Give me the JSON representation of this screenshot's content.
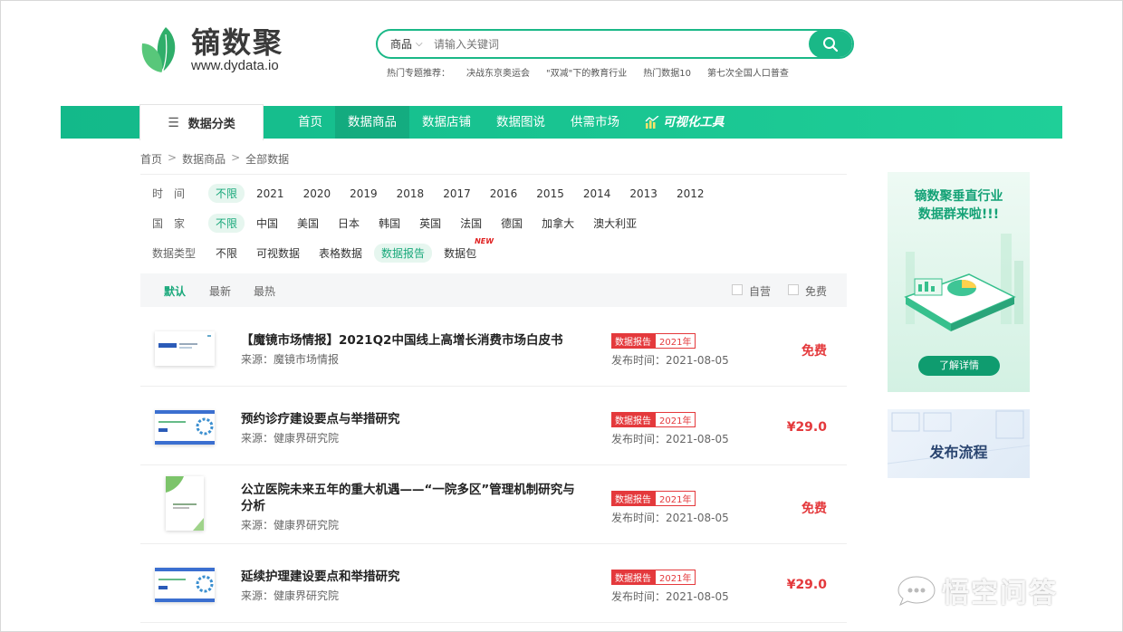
{
  "logo": {
    "name": "镝数聚",
    "url": "www.dydata.io"
  },
  "search": {
    "category": "商品",
    "placeholder": "请输入关键词"
  },
  "hot_topics": {
    "label": "热门专题推荐：",
    "items": [
      "决战东京奥运会",
      "\"双减\"下的教育行业",
      "热门数据10",
      "第七次全国人口普查"
    ]
  },
  "nav": {
    "category_button": "数据分类",
    "items": [
      "首页",
      "数据商品",
      "数据店铺",
      "数据图说",
      "供需市场",
      "可视化工具"
    ],
    "active": "数据商品"
  },
  "breadcrumb": [
    "首页",
    "数据商品",
    "全部数据"
  ],
  "filters": {
    "time": {
      "label": "时　间",
      "options": [
        "不限",
        "2021",
        "2020",
        "2019",
        "2018",
        "2017",
        "2016",
        "2015",
        "2014",
        "2013",
        "2012"
      ]
    },
    "country": {
      "label": "国　家",
      "options": [
        "不限",
        "中国",
        "美国",
        "日本",
        "韩国",
        "英国",
        "法国",
        "德国",
        "加拿大",
        "澳大利亚"
      ]
    },
    "type": {
      "label": "数据类型",
      "options": [
        "不限",
        "可视数据",
        "表格数据",
        "数据报告",
        "数据包"
      ],
      "new_badge": "NEW"
    }
  },
  "sortbar": {
    "default": "默认",
    "latest": "最新",
    "hottest": "最热",
    "self_run": "自营",
    "free": "免费"
  },
  "items": [
    {
      "title": "【魔镜市场情报】2021Q2中国线上高增长消费市场白皮书",
      "source": "来源：魔镜市场情报",
      "tag": "数据报告",
      "year": "2021年",
      "date": "发布时间：2021-08-05",
      "price": "免费"
    },
    {
      "title": "预约诊疗建设要点与举措研究",
      "source": "来源：健康界研究院",
      "tag": "数据报告",
      "year": "2021年",
      "date": "发布时间：2021-08-05",
      "price": "¥29.0"
    },
    {
      "title": "公立医院未来五年的重大机遇——“一院多区”管理机制研究与分析",
      "source": "来源：健康界研究院",
      "tag": "数据报告",
      "year": "2021年",
      "date": "发布时间：2021-08-05",
      "price": "免费"
    },
    {
      "title": "延续护理建设要点和举措研究",
      "source": "来源：健康界研究院",
      "tag": "数据报告",
      "year": "2021年",
      "date": "发布时间：2021-08-05",
      "price": "¥29.0"
    }
  ],
  "banner": {
    "line1": "镝数聚垂直行业",
    "line2": "数据群来啦!!!",
    "cta": "了解详情"
  },
  "banner2": {
    "text": "发布流程"
  },
  "watermark": "悟空问答",
  "colors": {
    "brand": "#1ab887",
    "price": "#e4393c"
  }
}
